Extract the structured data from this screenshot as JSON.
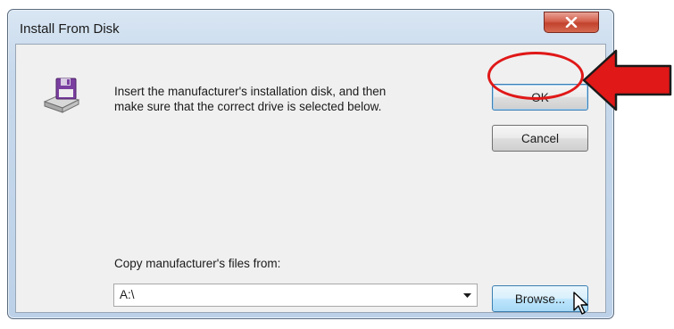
{
  "window": {
    "title": "Install From Disk",
    "close_icon": "close-icon"
  },
  "dialog": {
    "icon": "floppy-disk-drive-icon",
    "instruction_line1": "Insert the manufacturer's installation disk, and then",
    "instruction_line2": "make sure that the correct drive is selected below.",
    "ok_label": "OK",
    "cancel_label": "Cancel",
    "copy_label": "Copy manufacturer's files from:",
    "source_path": "A:\\",
    "browse_label": "Browse..."
  },
  "annotation": {
    "highlight_color": "#e01818",
    "targets": "ok-button"
  }
}
